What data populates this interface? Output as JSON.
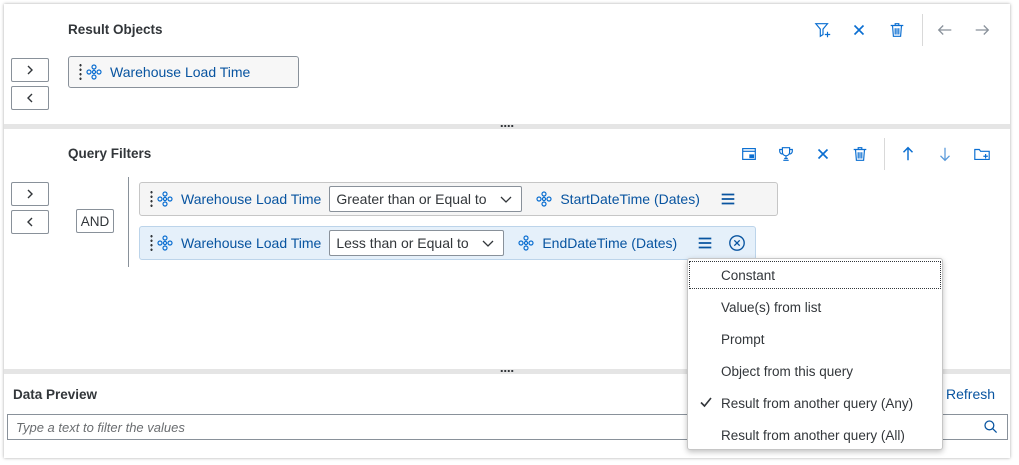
{
  "result_objects": {
    "title": "Result Objects",
    "item_label": "Warehouse Load Time"
  },
  "query_filters": {
    "title": "Query Filters",
    "and_label": "AND",
    "rows": [
      {
        "object": "Warehouse Load Time",
        "operator": "Greater than or Equal to",
        "operand": "StartDateTime (Dates)"
      },
      {
        "object": "Warehouse Load Time",
        "operator": "Less than or Equal to",
        "operand": "EndDateTime (Dates)"
      }
    ]
  },
  "operand_menu": {
    "items": [
      {
        "label": "Constant",
        "checked": false
      },
      {
        "label": "Value(s) from list",
        "checked": false
      },
      {
        "label": "Prompt",
        "checked": false
      },
      {
        "label": "Object from this query",
        "checked": false
      },
      {
        "label": "Result from another query (Any)",
        "checked": true
      },
      {
        "label": "Result from another query (All)",
        "checked": false
      }
    ]
  },
  "data_preview": {
    "title": "Data Preview",
    "refresh_label": "Refresh",
    "search_placeholder": "Type a text to filter the values"
  },
  "icons": {
    "object": "dimension-icon",
    "add_filter": "add-filter-icon",
    "clear": "close-icon",
    "delete": "delete-icon",
    "back": "arrow-left-icon",
    "forward": "arrow-right-icon"
  },
  "colors": {
    "accent": "#0a6ed1",
    "link": "#0854a0",
    "selected_row": "#e5f0fa"
  }
}
